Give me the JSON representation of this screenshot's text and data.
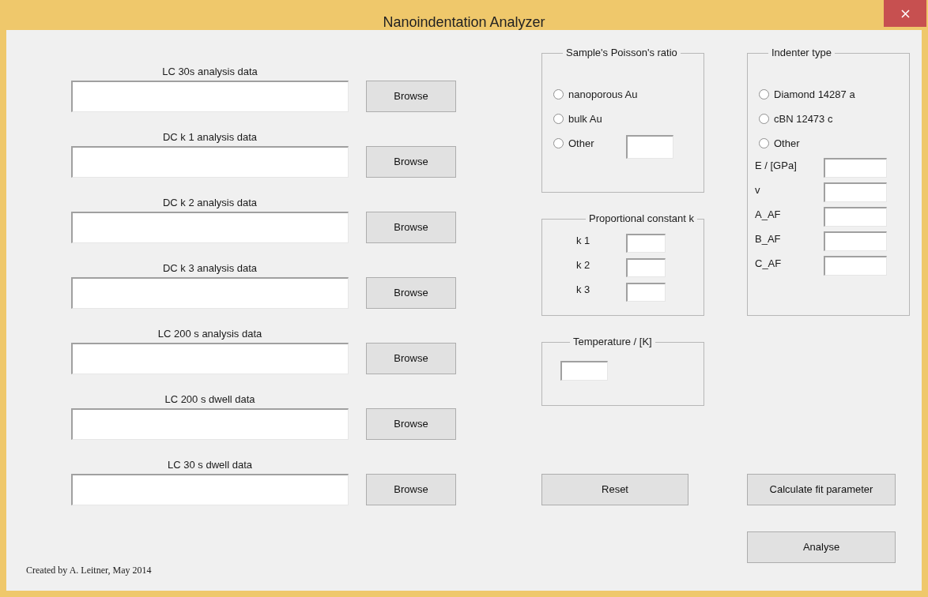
{
  "window": {
    "title": "Nanoindentation Analyzer"
  },
  "file_inputs": [
    {
      "label": "LC 30s analysis data",
      "button": "Browse"
    },
    {
      "label": "DC k 1 analysis data",
      "button": "Browse"
    },
    {
      "label": "DC k 2 analysis data",
      "button": "Browse"
    },
    {
      "label": "DC k 3 analysis data",
      "button": "Browse"
    },
    {
      "label": "LC 200 s analysis data",
      "button": "Browse"
    },
    {
      "label": "LC 200 s dwell data",
      "button": "Browse"
    },
    {
      "label": "LC 30 s dwell data",
      "button": "Browse"
    }
  ],
  "poisson_ratio": {
    "title": "Sample's Poisson's ratio",
    "options": [
      {
        "label": "nanoporous Au",
        "selected": false,
        "kind": "plain"
      },
      {
        "label": "bulk Au",
        "selected": false,
        "kind": "plain"
      },
      {
        "label": "Other",
        "selected": false,
        "kind": "field"
      }
    ]
  },
  "proportional_constant": {
    "title": "Proportional constant k",
    "fields": [
      {
        "label": "k 1"
      },
      {
        "label": "k 2"
      },
      {
        "label": "k 3"
      }
    ]
  },
  "temperature": {
    "title": "Temperature / [K]"
  },
  "indenter_type": {
    "title": "Indenter type",
    "options": [
      {
        "label": "Diamond 14287 a",
        "selected": false
      },
      {
        "label": "cBN 12473 c",
        "selected": false
      },
      {
        "label": "Other",
        "selected": false
      }
    ],
    "fields": [
      {
        "label": "E / [GPa]"
      },
      {
        "label": "v"
      },
      {
        "label": "A_AF"
      },
      {
        "label": "B_AF"
      },
      {
        "label": "C_AF"
      }
    ]
  },
  "reset_button": "Reset",
  "calculate_button": "Calculate fit parameter",
  "analyse_button": "Analyse",
  "footer": "Created by A. Leitner, May 2014"
}
